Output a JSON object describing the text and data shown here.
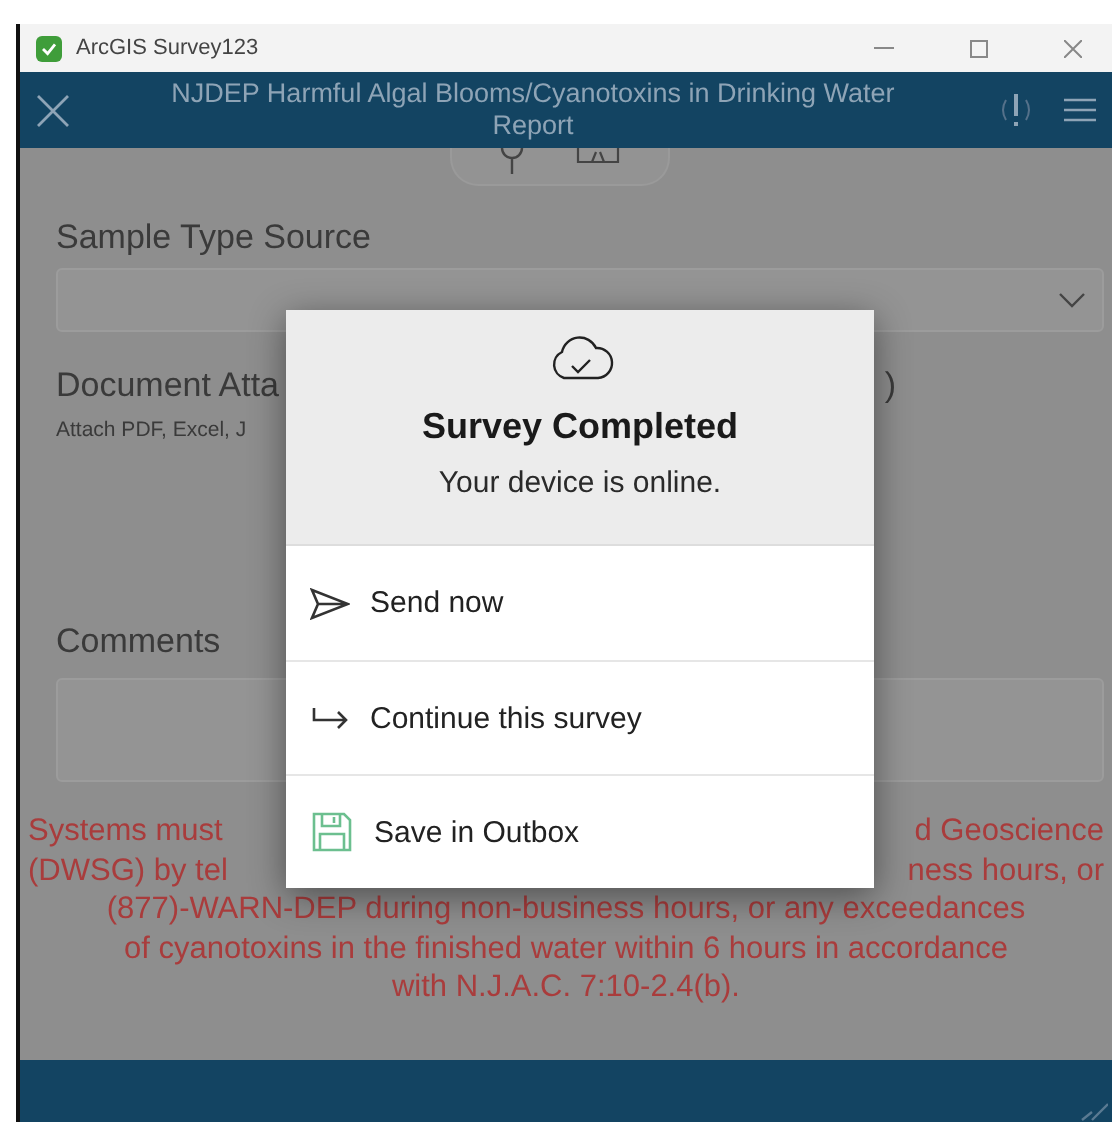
{
  "window": {
    "title": "ArcGIS Survey123"
  },
  "header": {
    "title": "NJDEP Harmful Algal Blooms/Cyanotoxins in Drinking Water Report"
  },
  "fields": [
    {
      "kind": "select",
      "label": "Sample Type Source"
    },
    {
      "kind": "attachment",
      "label": "Document Atta",
      "label_end": ")",
      "hint": "Attach PDF, Excel, J"
    },
    {
      "kind": "textarea",
      "label": "Comments"
    }
  ],
  "notice": {
    "lines": [
      {
        "left": "Systems must",
        "right": "d Geoscience"
      },
      {
        "left": "(DWSG) by tel",
        "right": "ness hours, or"
      },
      {
        "text": "(877)-WARN-DEP during non-business hours, or any exceedances"
      },
      {
        "text": "of cyanotoxins in the finished water within 6 hours in accordance"
      },
      {
        "text": "with N.J.A.C. 7:10-2.4(b)."
      }
    ]
  },
  "dialog": {
    "title": "Survey Completed",
    "message": "Your device is online.",
    "actions": [
      {
        "kind": "send",
        "label": "Send now"
      },
      {
        "kind": "continue",
        "label": "Continue this survey"
      },
      {
        "kind": "save",
        "label": "Save in Outbox"
      }
    ]
  }
}
